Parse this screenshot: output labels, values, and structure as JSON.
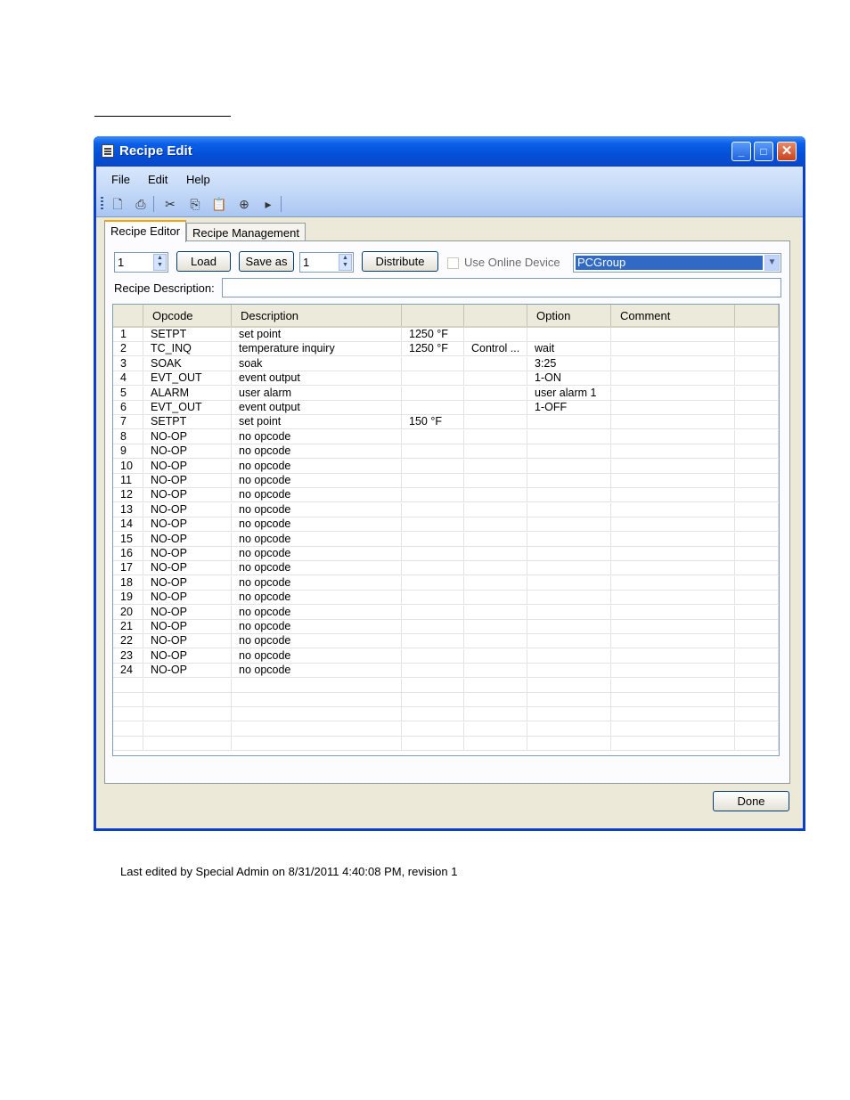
{
  "window": {
    "title": "Recipe Edit",
    "minimize": "_",
    "maximize": "□",
    "close": "✕"
  },
  "menu": [
    "File",
    "Edit",
    "Help"
  ],
  "toolbar": [
    "new-icon",
    "print-icon",
    "cut-icon",
    "copy-icon",
    "paste-icon",
    "insert-icon",
    "run-icon"
  ],
  "tabs": [
    "Recipe Editor",
    "Recipe Management"
  ],
  "controls": {
    "recipe_number": "1",
    "load_label": "Load",
    "save_as_label": "Save as",
    "save_as_number": "1",
    "distribute_label": "Distribute",
    "use_online_device_label": "Use Online Device",
    "use_online_device_checked": false,
    "device_group": "PCGroup",
    "recipe_description_label": "Recipe Description:",
    "recipe_description_value": ""
  },
  "grid": {
    "columns": [
      "",
      "Opcode",
      "Description",
      "",
      "",
      "Option",
      "Comment",
      ""
    ],
    "rows": [
      [
        "1",
        "SETPT",
        "set point",
        "1250 °F",
        "",
        "",
        ""
      ],
      [
        "2",
        "TC_INQ",
        "temperature inquiry",
        "1250 °F",
        "Control ...",
        "wait",
        ""
      ],
      [
        "3",
        "SOAK",
        "soak",
        "",
        "",
        "3:25",
        ""
      ],
      [
        "4",
        "EVT_OUT",
        "event output",
        "",
        "",
        "1-ON",
        ""
      ],
      [
        "5",
        "ALARM",
        "user alarm",
        "",
        "",
        "user alarm 1",
        ""
      ],
      [
        "6",
        "EVT_OUT",
        "event output",
        "",
        "",
        "1-OFF",
        ""
      ],
      [
        "7",
        "SETPT",
        "set point",
        "150 °F",
        "",
        "",
        ""
      ],
      [
        "8",
        "NO-OP",
        "no opcode",
        "",
        "",
        "",
        ""
      ],
      [
        "9",
        "NO-OP",
        "no opcode",
        "",
        "",
        "",
        ""
      ],
      [
        "10",
        "NO-OP",
        "no opcode",
        "",
        "",
        "",
        ""
      ],
      [
        "11",
        "NO-OP",
        "no opcode",
        "",
        "",
        "",
        ""
      ],
      [
        "12",
        "NO-OP",
        "no opcode",
        "",
        "",
        "",
        ""
      ],
      [
        "13",
        "NO-OP",
        "no opcode",
        "",
        "",
        "",
        ""
      ],
      [
        "14",
        "NO-OP",
        "no opcode",
        "",
        "",
        "",
        ""
      ],
      [
        "15",
        "NO-OP",
        "no opcode",
        "",
        "",
        "",
        ""
      ],
      [
        "16",
        "NO-OP",
        "no opcode",
        "",
        "",
        "",
        ""
      ],
      [
        "17",
        "NO-OP",
        "no opcode",
        "",
        "",
        "",
        ""
      ],
      [
        "18",
        "NO-OP",
        "no opcode",
        "",
        "",
        "",
        ""
      ],
      [
        "19",
        "NO-OP",
        "no opcode",
        "",
        "",
        "",
        ""
      ],
      [
        "20",
        "NO-OP",
        "no opcode",
        "",
        "",
        "",
        ""
      ],
      [
        "21",
        "NO-OP",
        "no opcode",
        "",
        "",
        "",
        ""
      ],
      [
        "22",
        "NO-OP",
        "no opcode",
        "",
        "",
        "",
        ""
      ],
      [
        "23",
        "NO-OP",
        "no opcode",
        "",
        "",
        "",
        ""
      ],
      [
        "24",
        "NO-OP",
        "no opcode",
        "",
        "",
        "",
        ""
      ],
      [
        "",
        "",
        "",
        "",
        "",
        "",
        ""
      ],
      [
        "",
        "",
        "",
        "",
        "",
        "",
        ""
      ],
      [
        "",
        "",
        "",
        "",
        "",
        "",
        ""
      ],
      [
        "",
        "",
        "",
        "",
        "",
        "",
        ""
      ],
      [
        "",
        "",
        "",
        "",
        "",
        "",
        ""
      ]
    ]
  },
  "status": "Last edited by Special Admin on 8/31/2011 4:40:08 PM, revision 1",
  "done_label": "Done",
  "colors": {
    "titlebar": "#0a5fe8",
    "selection": "#316ac5",
    "tab_highlight": "#f5a40a"
  }
}
